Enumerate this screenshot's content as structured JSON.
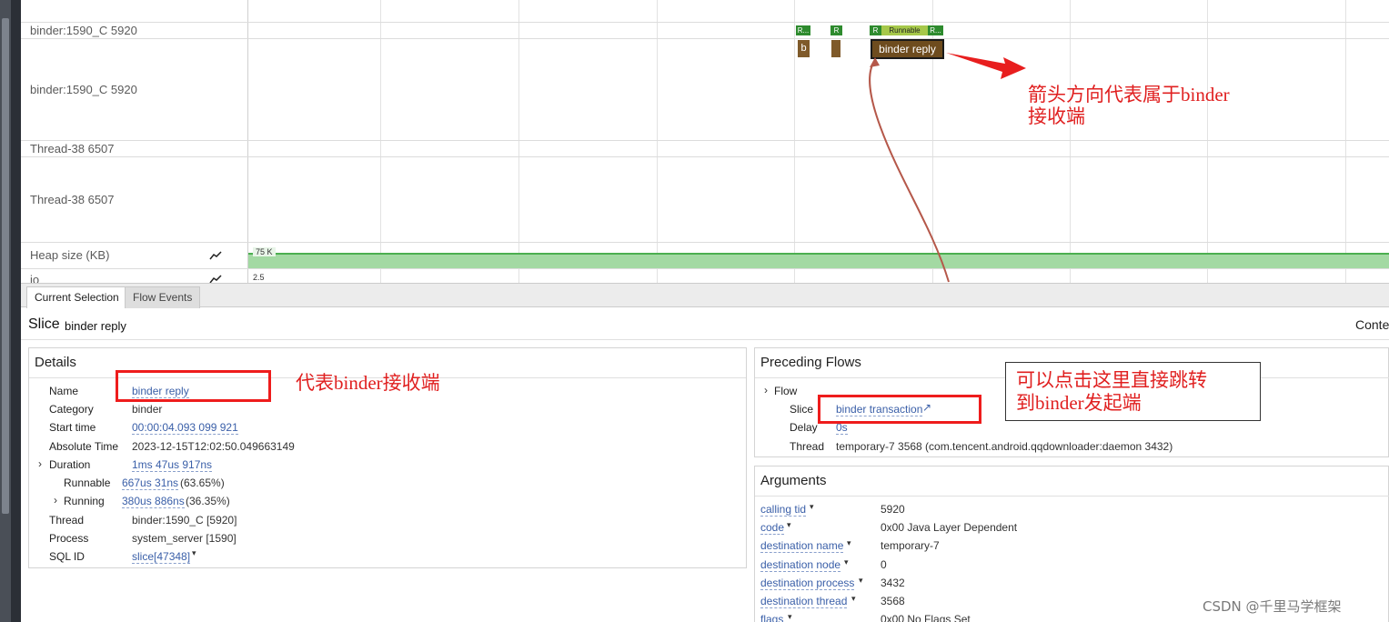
{
  "timeline": {
    "tracks": [
      {
        "label": "binder:1590_C 5920"
      },
      {
        "label": "binder:1590_C 5920"
      },
      {
        "label": "Thread-38 6507"
      },
      {
        "label": "Thread-38 6507"
      },
      {
        "label": "Heap size (KB)"
      },
      {
        "label": "io"
      }
    ],
    "states": [
      "R...",
      "R",
      "R",
      "Runnable",
      "R..."
    ],
    "slices": {
      "b1": "b",
      "main": "binder reply"
    },
    "heap_tick": "75 K",
    "io_tick": "2.5"
  },
  "annotations": {
    "arrow_note_1": "箭头方向代表属于binder",
    "arrow_note_2": "接收端",
    "name_note": "代表binder接收端",
    "flow_note_1": "可以点击这里直接跳转",
    "flow_note_2": "到binder发起端"
  },
  "tabs": [
    {
      "label": "Current Selection"
    },
    {
      "label": "Flow Events"
    }
  ],
  "header": {
    "kind": "Slice",
    "name": "binder reply",
    "right_cut": "Conte"
  },
  "details": {
    "title": "Details",
    "rows": [
      {
        "key": "Name",
        "value": "binder reply"
      },
      {
        "key": "Category",
        "value": "binder"
      },
      {
        "key": "Start time",
        "value": "00:00:04.093 099 921"
      },
      {
        "key": "Absolute Time",
        "value": "2023-12-15T12:02:50.049663149"
      },
      {
        "key": "Duration",
        "value": "1ms 47us 917ns"
      },
      {
        "key": "Runnable",
        "value": "667us 31ns",
        "pct": "(63.65%)"
      },
      {
        "key": "Running",
        "value": "380us 886ns",
        "pct": "(36.35%)"
      },
      {
        "key": "Thread",
        "value": "binder:1590_C [5920]"
      },
      {
        "key": "Process",
        "value": "system_server [1590]"
      },
      {
        "key": "SQL ID",
        "value": "slice[47348]"
      }
    ]
  },
  "preceding": {
    "title": "Preceding Flows",
    "flow_label": "Flow",
    "rows": [
      {
        "key": "Slice",
        "value": "binder transaction"
      },
      {
        "key": "Delay",
        "value": "0s"
      },
      {
        "key": "Thread",
        "value": "temporary-7 3568 (com.tencent.android.qqdownloader:daemon 3432)"
      }
    ]
  },
  "arguments": {
    "title": "Arguments",
    "rows": [
      {
        "key": "calling tid",
        "value": "5920"
      },
      {
        "key": "code",
        "value": "0x00 Java Layer Dependent"
      },
      {
        "key": "destination name",
        "value": "temporary-7"
      },
      {
        "key": "destination node",
        "value": "0"
      },
      {
        "key": "destination process",
        "value": "3432"
      },
      {
        "key": "destination thread",
        "value": "3568"
      },
      {
        "key": "flags",
        "value": "0x00 No Flags Set"
      }
    ]
  },
  "watermark": "CSDN @千里马学框架"
}
